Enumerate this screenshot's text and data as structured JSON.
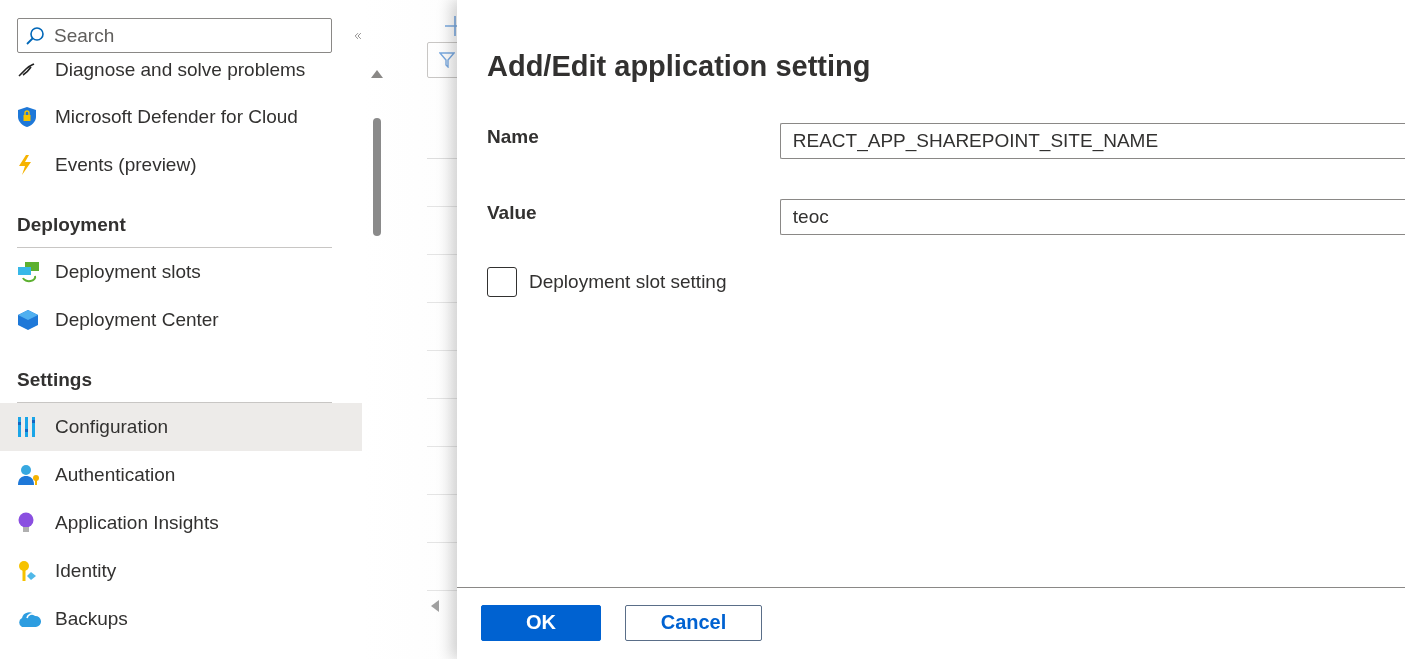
{
  "sidebar": {
    "search": {
      "placeholder": "Search"
    },
    "items": [
      {
        "kind": "item",
        "label": "Diagnose and solve problems",
        "selected": false
      },
      {
        "kind": "item",
        "label": "Microsoft Defender for Cloud",
        "selected": false
      },
      {
        "kind": "item",
        "label": "Events (preview)",
        "selected": false
      },
      {
        "kind": "header",
        "label": "Deployment"
      },
      {
        "kind": "item",
        "label": "Deployment slots",
        "selected": false
      },
      {
        "kind": "item",
        "label": "Deployment Center",
        "selected": false
      },
      {
        "kind": "header",
        "label": "Settings"
      },
      {
        "kind": "item",
        "label": "Configuration",
        "selected": true
      },
      {
        "kind": "item",
        "label": "Authentication",
        "selected": false
      },
      {
        "kind": "item",
        "label": "Application Insights",
        "selected": false
      },
      {
        "kind": "item",
        "label": "Identity",
        "selected": false
      },
      {
        "kind": "item",
        "label": "Backups",
        "selected": false
      }
    ]
  },
  "dialog": {
    "title": "Add/Edit application setting",
    "fields": [
      {
        "label": "Name",
        "value": "REACT_APP_SHAREPOINT_SITE_NAME"
      },
      {
        "label": "Value",
        "value": "teoc"
      }
    ],
    "slot_setting": {
      "label": "Deployment slot setting",
      "checked": false
    },
    "buttons": [
      {
        "kind": "primary",
        "label": "OK"
      },
      {
        "kind": "secondary",
        "label": "Cancel"
      }
    ]
  }
}
